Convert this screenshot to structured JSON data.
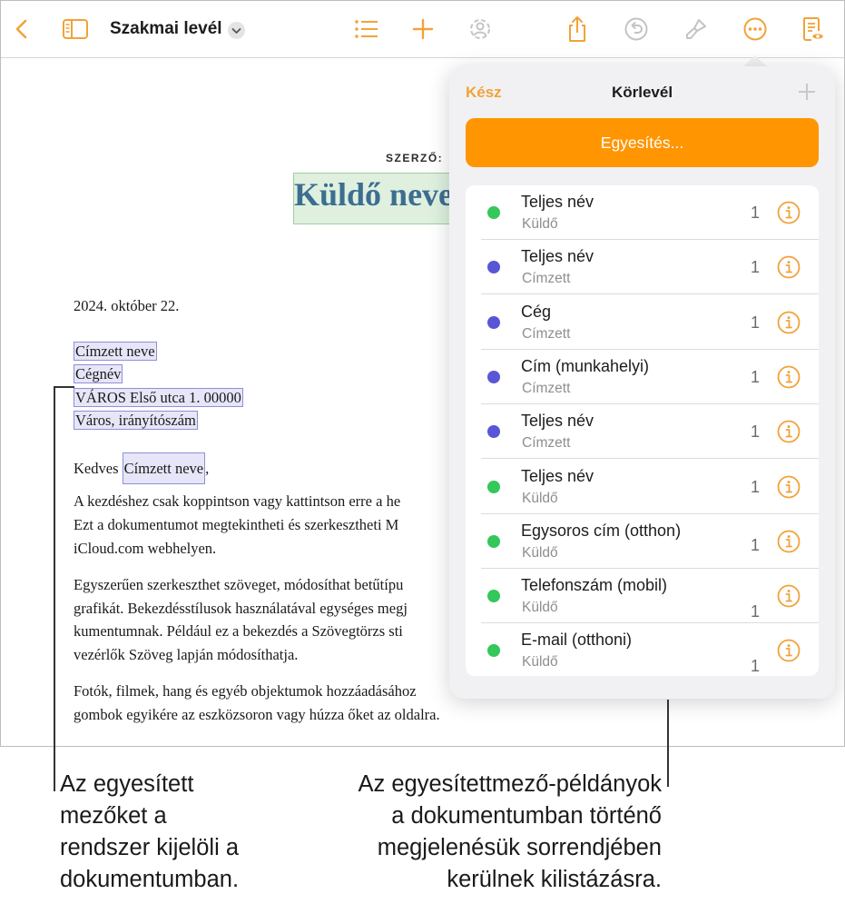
{
  "toolbar": {
    "back_icon": "chevron-left-icon",
    "sidebar_icon": "sidebar-icon",
    "document_title": "Szakmai levél",
    "title_chevron_icon": "chevron-down-icon",
    "list_icon": "list-icon",
    "add_icon": "plus-icon",
    "collaborate_icon": "collaborate-icon",
    "share_icon": "share-icon",
    "undo_icon": "undo-icon",
    "format_icon": "paintbrush-icon",
    "more_icon": "ellipsis-circle-icon",
    "view_icon": "reading-view-icon",
    "accent_color": "#f2a23a"
  },
  "document": {
    "author_label": "SZERZŐ:",
    "sender_name": "Küldő neve",
    "date": "2024. október 22.",
    "recipient_name": "Címzett neve",
    "company": "Cégnév",
    "address_line": "VÁROS Első utca 1. 00000",
    "city_line": "Város, irányítószám",
    "greeting_prefix": "Kedves",
    "greeting_field": "Címzett neve",
    "greeting_suffix": ",",
    "para1": [
      "A kezdéshez csak koppintson vagy kattintson erre a he",
      "Ezt a dokumentumot megtekintheti és szerkesztheti M",
      "iCloud.com webhelyen."
    ],
    "para2": [
      "Egyszerűen szerkeszthet szöveget, módosíthat betűtípu",
      "grafikát. Bekezdésstílusok használatával egységes megj",
      "kumentumnak. Például ez a bekezdés a Szövegtörzs sti",
      "vezérlők Szöveg lapján módosíthatja."
    ],
    "para3": [
      "Fotók, filmek, hang és egyéb objektumok hozzáadásához",
      "gombok egyikére az eszközsoron vagy húzza őket az oldalra."
    ]
  },
  "popover": {
    "done_label": "Kész",
    "title": "Körlevél",
    "add_icon": "plus-icon",
    "merge_button": "Egyesítés...",
    "button_color": "#ff9500",
    "sender_color": "#34c759",
    "recipient_color": "#5856d6",
    "fields": [
      {
        "name": "Teljes név",
        "role": "Küldő",
        "count": "1",
        "kind": "sender"
      },
      {
        "name": "Teljes név",
        "role": "Címzett",
        "count": "1",
        "kind": "recipient"
      },
      {
        "name": "Cég",
        "role": "Címzett",
        "count": "1",
        "kind": "recipient"
      },
      {
        "name": "Cím (munkahelyi)",
        "role": "Címzett",
        "count": "1",
        "kind": "recipient"
      },
      {
        "name": "Teljes név",
        "role": "Címzett",
        "count": "1",
        "kind": "recipient"
      },
      {
        "name": "Teljes név",
        "role": "Küldő",
        "count": "1",
        "kind": "sender"
      },
      {
        "name": "Egysoros cím (otthon)",
        "role": "Küldő",
        "count": "1",
        "kind": "sender"
      },
      {
        "name": "Telefonszám (mobil)",
        "role": "Küldő",
        "count": "1",
        "kind": "sender"
      },
      {
        "name": "E-mail (otthoni)",
        "role": "Küldő",
        "count": "1",
        "kind": "sender"
      }
    ],
    "info_icon": "info-circle-icon"
  },
  "captions": {
    "left": [
      "Az egyesített",
      "mezőket a",
      "rendszer kijelöli a",
      "dokumentumban."
    ],
    "right": [
      "Az egyesítettmező-példányok",
      "a dokumentumban történő",
      "megjelenésük sorrendjében",
      "kerülnek kilistázásra."
    ]
  }
}
